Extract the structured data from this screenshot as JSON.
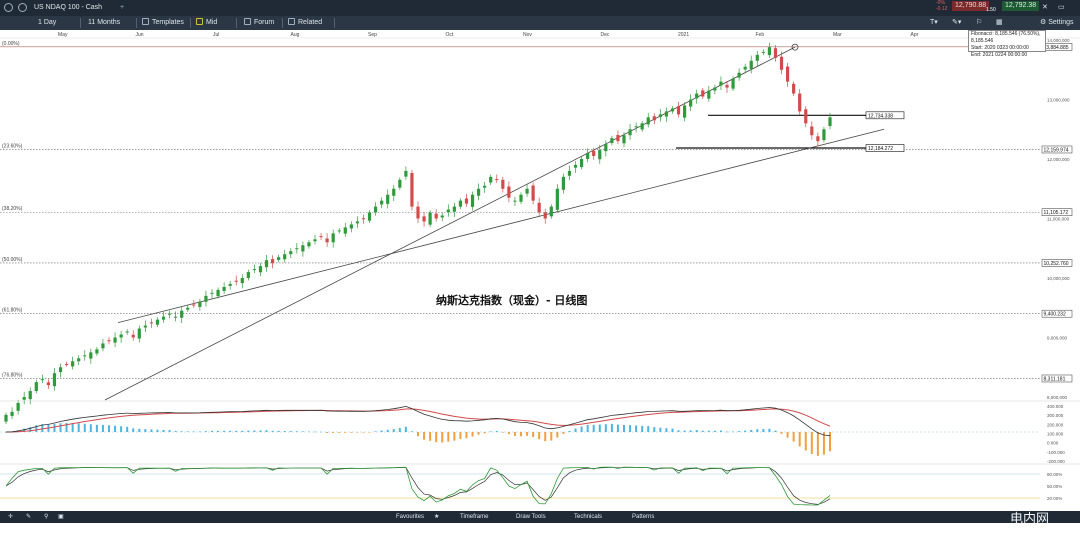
{
  "topbar": {
    "instrument": "US NDAQ 100 - Cash",
    "plus": "+",
    "sell_price": "12,790.88",
    "buy_price": "12,792.38",
    "spread": "1.50",
    "change_top": "-0%",
    "change_bottom": "-0.12",
    "settings": "Settings",
    "colors": {
      "sell": "#c23b3b",
      "buy": "#1f7b3a"
    }
  },
  "toolbar": {
    "interval": "1 Day",
    "range": "11 Months",
    "templates": "Templates",
    "mid": "Mid",
    "forum": "Forum",
    "related": "Related"
  },
  "info_box": {
    "line1": "Fibonacci: 8,185.546 (76.50%), 8,185.546",
    "line2": "Start: 2020 0323 00:00:00",
    "line3": "End: 2021 0224 00:00:00"
  },
  "bottombar": {
    "tabs": [
      "Favourites",
      "Timeframe",
      "Draw Tools",
      "Technicals",
      "Patterns"
    ]
  },
  "chart_data": {
    "type": "candlestick",
    "title": "纳斯达克指数（现金）- 日线图",
    "months": [
      "May",
      "Jun",
      "Jul",
      "Aug",
      "Sep",
      "Oct",
      "Nov",
      "Dec",
      "2021",
      "Feb",
      "Mar",
      "Apr"
    ],
    "y_ticks": [
      "14,000,000",
      "13,000,000",
      "12,000,000",
      "11,000,000",
      "10,000,000",
      "9,000,000",
      "8,000,000"
    ],
    "fib_levels": [
      {
        "pct": "(0.00%)",
        "value": "13,884.885"
      },
      {
        "pct": "(23.60%)",
        "value": "12,159.974"
      },
      {
        "pct": "(38.20%)",
        "value": "11,105.172"
      },
      {
        "pct": "(50.00%)",
        "value": "10,252.760"
      },
      {
        "pct": "(61.80%)",
        "value": "9,400.232"
      },
      {
        "pct": "(76.80%)",
        "value": "8,311.181"
      }
    ],
    "horizontal_levels": [
      {
        "value": "12,734.338"
      },
      {
        "value": "12,184.272"
      }
    ],
    "closes": [
      7700,
      7750,
      7900,
      8000,
      8100,
      8250,
      8300,
      8200,
      8400,
      8500,
      8550,
      8600,
      8650,
      8700,
      8750,
      8800,
      8900,
      8950,
      9000,
      9050,
      9100,
      9000,
      9150,
      9200,
      9250,
      9300,
      9350,
      9400,
      9350,
      9450,
      9500,
      9550,
      9600,
      9700,
      9750,
      9800,
      9850,
      9900,
      9950,
      10000,
      10100,
      10150,
      10200,
      10300,
      10250,
      10350,
      10400,
      10450,
      10500,
      10550,
      10600,
      10650,
      10700,
      10600,
      10750,
      10800,
      10850,
      10900,
      10950,
      11000,
      11100,
      11200,
      11300,
      11400,
      11500,
      11650,
      11800,
      11200,
      11000,
      10950,
      11100,
      11000,
      11050,
      11150,
      11200,
      11300,
      11250,
      11400,
      11500,
      11550,
      11700,
      11650,
      11500,
      11350,
      11300,
      11400,
      11500,
      11300,
      11100,
      11000,
      11200,
      11500,
      11700,
      11800,
      11900,
      12000,
      12100,
      12050,
      12150,
      12250,
      12350,
      12300,
      12400,
      12500,
      12550,
      12600,
      12700,
      12650,
      12750,
      12800,
      12850,
      12750,
      12900,
      13000,
      13100,
      13050,
      13150,
      13200,
      13300,
      13200,
      13350,
      13450,
      13550,
      13650,
      13750,
      13800,
      13880,
      13700,
      13500,
      13300,
      13100,
      12800,
      12600,
      12400,
      12300,
      12500,
      12700
    ],
    "macd_label_ticks": [
      "400.000",
      "300.000",
      "200.000",
      "100.000",
      "0.000",
      "-100.000",
      "-200.000"
    ],
    "stoch_label_ticks": [
      "80.00%",
      "50.00%",
      "20.00%"
    ],
    "watermark": "电内网 hazaud"
  }
}
